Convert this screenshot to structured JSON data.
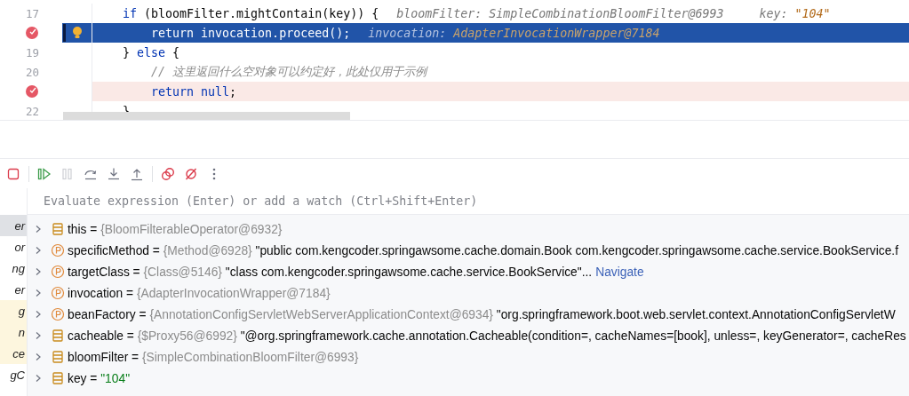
{
  "editor": {
    "lines": [
      {
        "number": "17",
        "breakpoint": false,
        "current": false,
        "highlighted": false,
        "tokens": [
          {
            "kind": "keyword",
            "text": "if"
          },
          {
            "kind": "plain",
            "text": " (bloomFilter.mightContain(key)) {"
          },
          {
            "kind": "hint",
            "text": "bloomFilter: SimpleCombinationBloomFilter@6993"
          },
          {
            "kind": "hint",
            "text": "key: "
          },
          {
            "kind": "hint-value",
            "text": "\"104\""
          }
        ]
      },
      {
        "breakpoint": true,
        "current": true,
        "highlighted": false,
        "tokens": [
          {
            "kind": "keyword",
            "text": "    return"
          },
          {
            "kind": "plain",
            "text": " invocation.proceed();"
          },
          {
            "kind": "hint",
            "text": "invocation: "
          },
          {
            "kind": "hint-value",
            "text": "AdapterInvocationWrapper@7184"
          }
        ]
      },
      {
        "number": "19",
        "breakpoint": false,
        "current": false,
        "highlighted": false,
        "tokens": [
          {
            "kind": "plain",
            "text": "} "
          },
          {
            "kind": "keyword",
            "text": "else"
          },
          {
            "kind": "plain",
            "text": " {"
          }
        ]
      },
      {
        "number": "20",
        "breakpoint": false,
        "current": false,
        "highlighted": false,
        "tokens": [
          {
            "kind": "comment",
            "text": "    // 这里返回什么空对象可以约定好，此处仅用于示例"
          }
        ]
      },
      {
        "breakpoint": true,
        "current": false,
        "highlighted": true,
        "tokens": [
          {
            "kind": "keyword",
            "text": "    return null"
          },
          {
            "kind": "plain",
            "text": ";"
          }
        ]
      },
      {
        "number": "22",
        "breakpoint": false,
        "current": false,
        "highlighted": false,
        "tokens": [
          {
            "kind": "plain",
            "text": "}"
          }
        ]
      }
    ]
  },
  "toolbar": [
    {
      "kind": "stop",
      "disabled": false
    },
    {
      "kind": "resume",
      "disabled": false
    },
    {
      "kind": "pause",
      "disabled": true
    },
    {
      "kind": "step-over",
      "disabled": false
    },
    {
      "kind": "step-into",
      "disabled": false
    },
    {
      "kind": "step-out",
      "disabled": false
    },
    {
      "kind": "breakpoints",
      "disabled": false
    },
    {
      "kind": "mute",
      "disabled": false
    },
    {
      "kind": "more",
      "disabled": false
    }
  ],
  "evaluate": {
    "placeholder": "Evaluate expression (Enter) or add a watch (Ctrl+Shift+Enter)"
  },
  "frames": [
    {
      "text": "er",
      "selected": true,
      "kind": "project"
    },
    {
      "text": "or",
      "selected": false,
      "kind": "project"
    },
    {
      "text": "ng",
      "selected": false,
      "kind": "project"
    },
    {
      "text": "er",
      "selected": false,
      "kind": "project"
    },
    {
      "text": "g",
      "selected": false,
      "kind": "library"
    },
    {
      "text": "n",
      "selected": false,
      "kind": "library"
    },
    {
      "text": "ce",
      "selected": false,
      "kind": "library"
    },
    {
      "text": "gC",
      "selected": false,
      "kind": "project"
    }
  ],
  "variables": [
    {
      "kind": "field",
      "name": "this =",
      "type": "{BloomFilterableOperator@6932}"
    },
    {
      "kind": "param",
      "name": "specificMethod =",
      "type": "{Method@6928}",
      "value": {
        "kind": "text",
        "text": "\"public com.kengcoder.springawsome.cache.domain.Book com.kengcoder.springawsome.cache.service.BookService.f"
      }
    },
    {
      "kind": "param",
      "name": "targetClass =",
      "type": "{Class@5146}",
      "value": {
        "kind": "text",
        "text": "\"class com.kengcoder.springawsome.cache.service.BookService\"..."
      },
      "link": "Navigate"
    },
    {
      "kind": "param",
      "name": "invocation =",
      "type": "{AdapterInvocationWrapper@7184}"
    },
    {
      "kind": "param",
      "name": "beanFactory =",
      "type": "{AnnotationConfigServletWebServerApplicationContext@6934}",
      "value": {
        "kind": "text",
        "text": "\"org.springframework.boot.web.servlet.context.AnnotationConfigServletW"
      }
    },
    {
      "kind": "field",
      "name": "cacheable =",
      "type": "{$Proxy56@6992}",
      "value": {
        "kind": "text",
        "text": "\"@org.springframework.cache.annotation.Cacheable(condition=, cacheNames=[book], unless=, keyGenerator=, cacheRes"
      }
    },
    {
      "kind": "field",
      "name": "bloomFilter =",
      "type": "{SimpleCombinationBloomFilter@6993}"
    },
    {
      "kind": "field",
      "name": "key =",
      "value": {
        "kind": "string",
        "text": "\"104\""
      }
    }
  ]
}
